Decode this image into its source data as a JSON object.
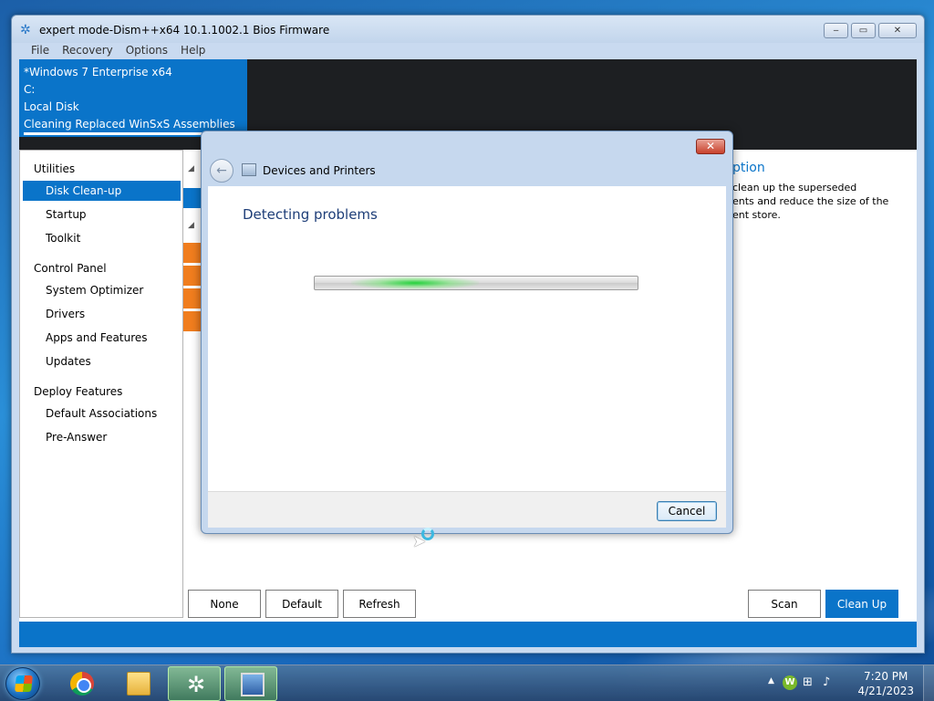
{
  "window": {
    "title": "expert mode-Dism++x64 10.1.1002.1 Bios Firmware",
    "controls": {
      "minimize": "‒",
      "maximize": "▭",
      "close": "✕"
    }
  },
  "menu": [
    "File",
    "Recovery",
    "Options",
    "Help"
  ],
  "image_info": {
    "os": "*Windows 7 Enterprise x64",
    "drive": "C:",
    "disk_type": "Local Disk",
    "status": "Cleaning Replaced WinSxS Assemblies"
  },
  "sidebar": {
    "groups": [
      {
        "label": "Utilities",
        "items": [
          "Disk Clean-up",
          "Startup",
          "Toolkit"
        ]
      },
      {
        "label": "Control Panel",
        "items": [
          "System Optimizer",
          "Drivers",
          "Apps and Features",
          "Updates"
        ]
      },
      {
        "label": "Deploy Features",
        "items": [
          "Default Associations",
          "Pre-Answer"
        ]
      }
    ],
    "active_item": "Disk Clean-up"
  },
  "description": {
    "title": "ption",
    "body_lines": [
      "clean up the superseded",
      "ents and reduce the size of the",
      "ent store."
    ]
  },
  "buttons": {
    "none": "None",
    "default": "Default",
    "refresh": "Refresh",
    "scan": "Scan",
    "cleanup": "Clean Up"
  },
  "dialog": {
    "breadcrumb": "Devices and Printers",
    "heading": "Detecting problems",
    "cancel": "Cancel",
    "close_glyph": "✕",
    "back_glyph": "←"
  },
  "taskbar": {
    "apps": [
      "start-orb",
      "chrome-icon",
      "file-explorer-icon",
      "dism-gear-icon",
      "remote-monitor-icon"
    ],
    "tray_up": "▲",
    "tray_w": "W",
    "time": "7:20 PM",
    "date": "4/21/2023"
  },
  "colors": {
    "accent": "#0a74c9",
    "orange": "#f07d1e",
    "dark_panel": "#1d1f22"
  }
}
